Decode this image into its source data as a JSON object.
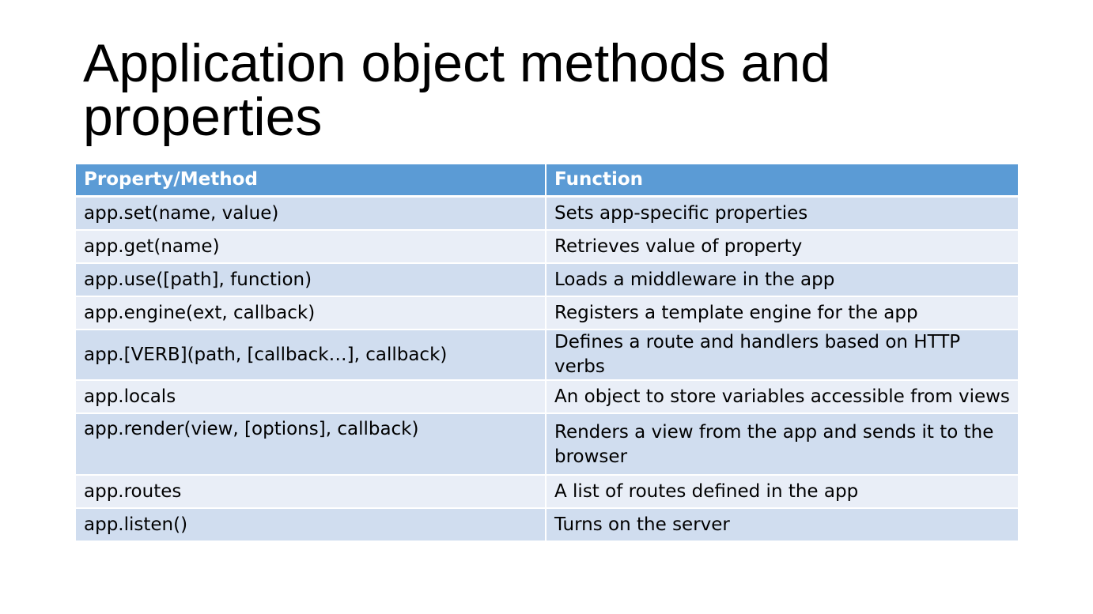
{
  "slide": {
    "title": "Application object methods and properties"
  },
  "table": {
    "headers": [
      "Property/Method",
      "Function"
    ],
    "rows": [
      [
        "app.set(name, value)",
        "Sets app-specific properties"
      ],
      [
        "app.get(name)",
        "Retrieves value of property"
      ],
      [
        "app.use([path], function)",
        "Loads a middleware in the app"
      ],
      [
        "app.engine(ext, callback)",
        "Registers a template engine for the app"
      ],
      [
        "app.[VERB](path, [callback…], callback)",
        "Defines a route and handlers based on HTTP verbs"
      ],
      [
        "app.locals",
        "An object to store variables accessible from views"
      ],
      [
        "app.render(view, [options], callback)",
        "Renders a view from the app and sends it to the browser"
      ],
      [
        "app.routes",
        "A list of routes defined in the app"
      ],
      [
        "app.listen()",
        "Turns on the server"
      ]
    ]
  },
  "colors": {
    "header_bg": "#5b9bd5",
    "row_odd_bg": "#d0ddef",
    "row_even_bg": "#e9eef7"
  }
}
